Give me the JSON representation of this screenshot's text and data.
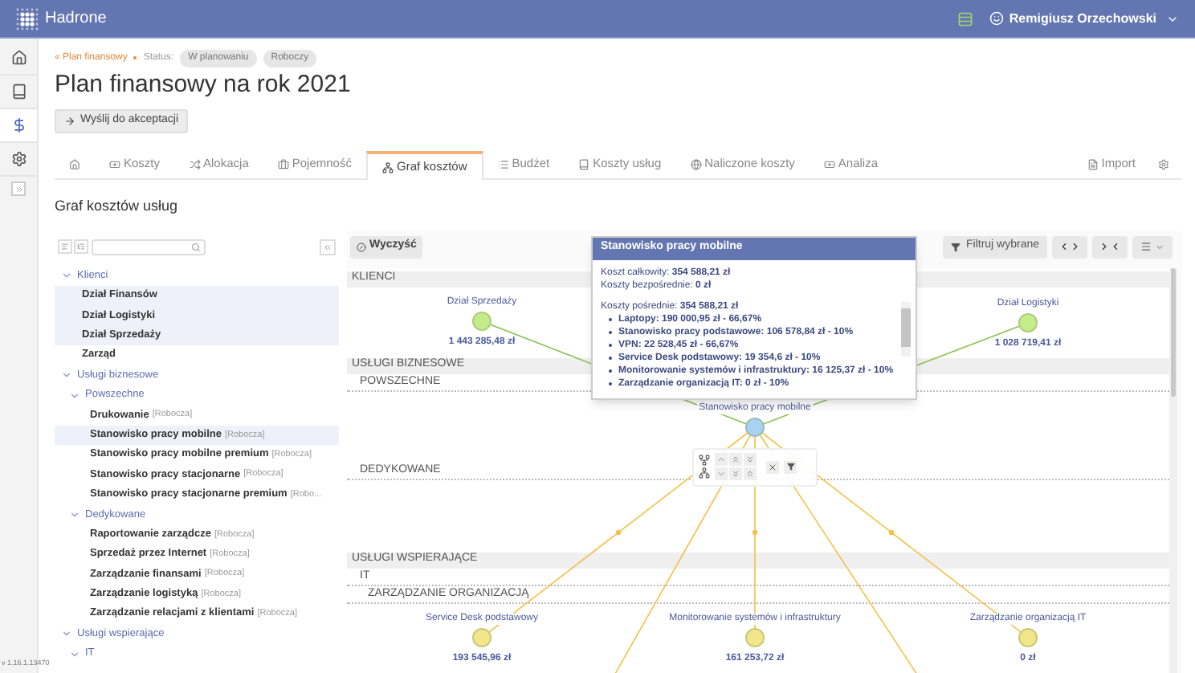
{
  "app": {
    "name": "Hadrone",
    "user": "Remigiusz Orzechowski"
  },
  "rail": [
    {
      "selected": false
    },
    {
      "selected": false
    },
    {
      "selected": true
    },
    {
      "selected": false
    }
  ],
  "breadcrumb": {
    "back": "« Plan finansowy",
    "status_label": "Status:",
    "badges": [
      "W planowaniu",
      "Roboczy"
    ]
  },
  "title": "Plan finansowy na rok 2021",
  "action_button": "Wyślij do akceptacji",
  "tabs": [
    {
      "selected": false
    },
    {
      "label": "Koszty",
      "selected": false
    },
    {
      "label": "Alokacja",
      "selected": false
    },
    {
      "label": "Pojemność",
      "selected": false
    },
    {
      "label": "Graf kosztów",
      "selected": true
    },
    {
      "label": "Budżet",
      "selected": false
    },
    {
      "label": "Koszty usług",
      "selected": false
    },
    {
      "label": "Naliczone koszty",
      "selected": false
    },
    {
      "label": "Analiza",
      "selected": false
    }
  ],
  "tab_actions": {
    "import": "Import"
  },
  "section_title": "Graf kosztów usług",
  "tree": [
    {
      "label": "Klienci",
      "expanded": true,
      "selected": false,
      "children": [
        {
          "label": "Dział Finansów",
          "selected": true
        },
        {
          "label": "Dział Logistyki",
          "selected": true
        },
        {
          "label": "Dział Sprzedaży",
          "selected": true
        },
        {
          "label": "Zarząd",
          "selected": false
        }
      ]
    },
    {
      "label": "Usługi biznesowe",
      "expanded": true,
      "selected": false,
      "children": [
        {
          "label": "Powszechne",
          "expanded": true,
          "selected": false,
          "children": [
            {
              "label": "Drukowanie",
              "tag": "[Robocza]",
              "selected": false
            },
            {
              "label": "Stanowisko pracy mobilne",
              "tag": "[Robocza]",
              "selected": true
            },
            {
              "label": "Stanowisko pracy mobilne premium",
              "tag": "[Robocza]",
              "selected": false
            },
            {
              "label": "Stanowisko pracy stacjonarne",
              "tag": "[Robocza]",
              "selected": false
            },
            {
              "label": "Stanowisko pracy stacjonarne premium",
              "tag": "[Robo...",
              "selected": false
            }
          ]
        },
        {
          "label": "Dedykowane",
          "expanded": true,
          "selected": false,
          "children": [
            {
              "label": "Raportowanie zarządcze",
              "tag": "[Robocza]",
              "selected": false
            },
            {
              "label": "Sprzedaż przez Internet",
              "tag": "[Robocza]",
              "selected": false
            },
            {
              "label": "Zarządzanie finansami",
              "tag": "[Robocza]",
              "selected": false
            },
            {
              "label": "Zarządzanie logistyką",
              "tag": "[Robocza]",
              "selected": false
            },
            {
              "label": "Zarządzanie relacjami z klientami",
              "tag": "[Robocza]",
              "selected": false
            }
          ]
        }
      ]
    },
    {
      "label": "Usługi wspierające",
      "expanded": true,
      "selected": false,
      "children": [
        {
          "label": "IT",
          "expanded": true,
          "selected": false
        }
      ]
    }
  ],
  "version": "v 1.16.1.13470",
  "graph_toolbar": {
    "clear": "Wyczyść",
    "filter": "Filtruj wybrane"
  },
  "graph_sections": [
    {
      "label": "KLIENCI",
      "kind": "group"
    },
    {
      "label": "USŁUGI BIZNESOWE",
      "kind": "group"
    },
    {
      "label": "POWSZECHNE",
      "kind": "subgroup"
    },
    {
      "label": "DEDYKOWANE",
      "kind": "subgroup"
    },
    {
      "label": "USŁUGI WSPIERAJĄCE",
      "kind": "group"
    },
    {
      "label": "IT",
      "kind": "subgroup"
    },
    {
      "label": "ZARZĄDZANIE ORGANIZACJĄ",
      "kind": "subsubgroup"
    }
  ],
  "nodes": [
    {
      "label": "Dział Sprzedaży",
      "value": "1 443 285,48 zł",
      "color": "#c5ec8a"
    },
    {
      "label": "Dział Logistyki",
      "value": "1 028 719,41 zł",
      "color": "#c5ec8a"
    },
    {
      "label": "Stanowisko pracy mobilne",
      "color": "#a9d2f2"
    },
    {
      "label": "Service Desk podstawowy",
      "value": "193 545,96 zł",
      "color": "#f3e58a"
    },
    {
      "label": "Monitorowanie systemów i infrastruktury",
      "value": "161 253,72 zł",
      "color": "#f3e58a"
    },
    {
      "label": "Zarządzanie organizacją IT",
      "value": "0 zł",
      "color": "#f3e58a"
    }
  ],
  "tooltip": {
    "title": "Stanowisko pracy mobilne",
    "lines": [
      "Koszt całkowity: **354 588,21 zł**",
      "Koszty bezpośrednie: **0 zł**"
    ],
    "indirect": "Koszty pośrednie: **354 588,21 zł**",
    "items": [
      "Laptopy: 190 000,95 zł - 66,67%",
      "Stanowisko pracy podstawowe: 106 578,84 zł - 10%",
      "VPN: 22 528,45 zł - 66,67%",
      "Service Desk podstawowy: 19 354,6 zł - 10%",
      "Monitorowanie systemów i infrastruktury: 16 125,37 zł - 10%",
      "Zarządzanie organizacją IT: 0 zł - 10%"
    ]
  }
}
